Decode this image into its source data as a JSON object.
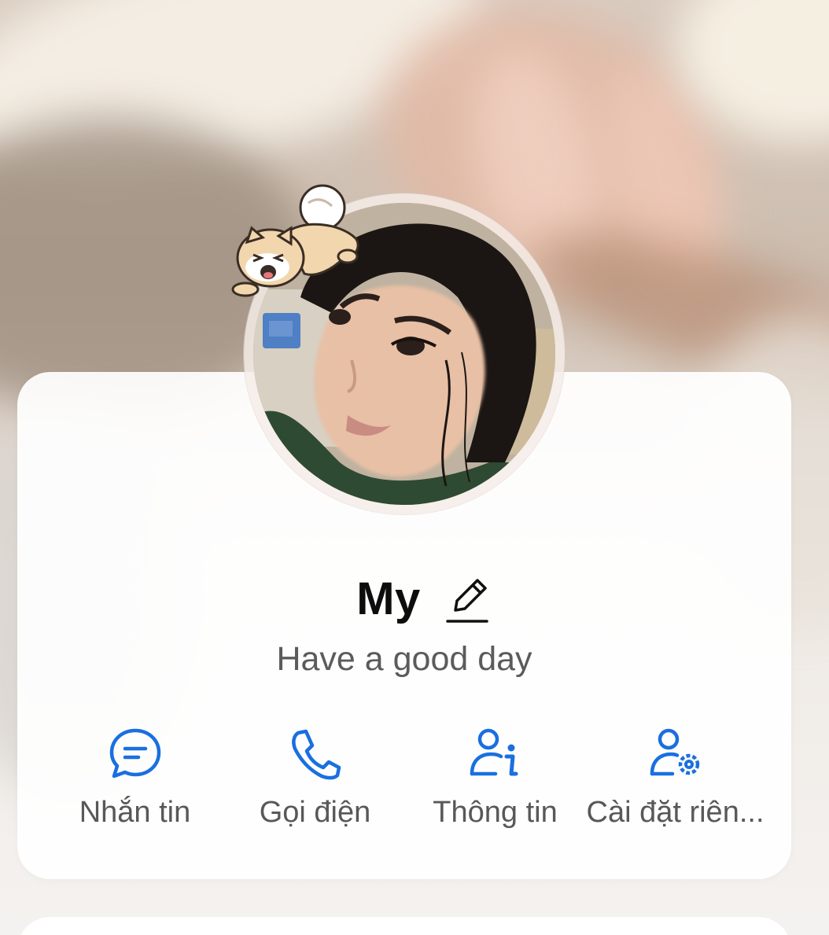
{
  "profile": {
    "name": "My",
    "status": "Have a good day"
  },
  "actions": [
    {
      "label": "Nhắn tin",
      "icon": "message-icon"
    },
    {
      "label": "Gọi điện",
      "icon": "phone-icon"
    },
    {
      "label": "Thông tin",
      "icon": "user-info-icon"
    },
    {
      "label": "Cài đặt riên...",
      "icon": "user-settings-icon"
    }
  ],
  "colors": {
    "accent": "#1a6fe0",
    "name_text": "#0d0d0d",
    "secondary_text": "#5b5b5b",
    "card": "#ffffff"
  }
}
